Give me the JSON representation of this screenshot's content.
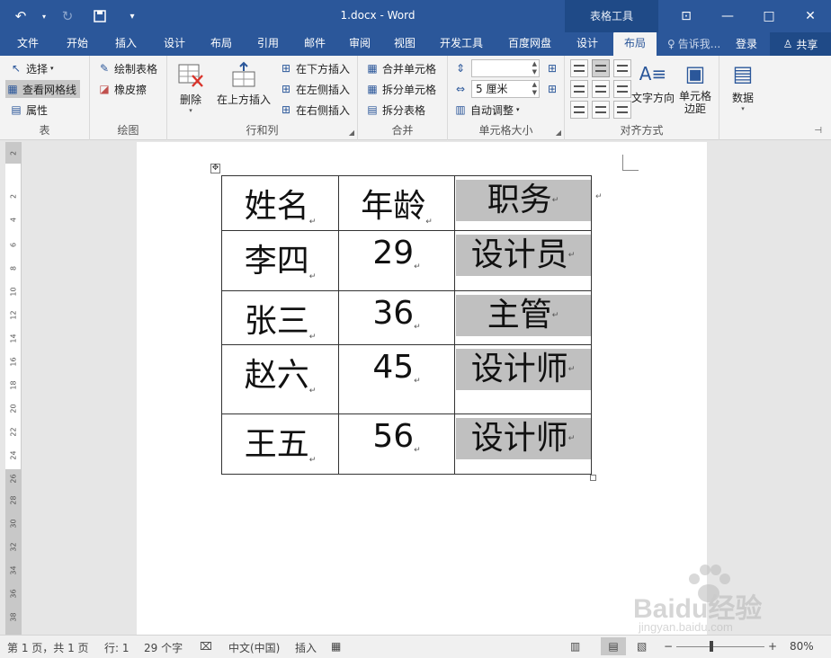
{
  "window": {
    "title": "1.docx - Word",
    "context_tab": "表格工具"
  },
  "tabs": [
    {
      "label": "文件"
    },
    {
      "label": "开始"
    },
    {
      "label": "插入"
    },
    {
      "label": "设计"
    },
    {
      "label": "布局"
    },
    {
      "label": "引用"
    },
    {
      "label": "邮件"
    },
    {
      "label": "审阅"
    },
    {
      "label": "视图"
    },
    {
      "label": "开发工具"
    },
    {
      "label": "百度网盘"
    },
    {
      "label": "设计"
    },
    {
      "label": "布局"
    }
  ],
  "tellme": "告诉我...",
  "signin": "登录",
  "share": "共享",
  "ribbon": {
    "table_group": {
      "label": "表",
      "select": "选择",
      "view_gridlines": "查看网格线",
      "properties": "属性"
    },
    "draw_group": {
      "label": "绘图",
      "draw_table": "绘制表格",
      "eraser": "橡皮擦"
    },
    "rowcol_group": {
      "label": "行和列",
      "delete": "删除",
      "insert_above": "在上方插入",
      "insert_below": "在下方插入",
      "insert_left": "在左侧插入",
      "insert_right": "在右侧插入"
    },
    "merge_group": {
      "label": "合并",
      "merge_cells": "合并单元格",
      "split_cells": "拆分单元格",
      "split_table": "拆分表格"
    },
    "cellsize_group": {
      "label": "单元格大小",
      "height_value": "",
      "width_value": "5 厘米",
      "autofit": "自动调整"
    },
    "align_group": {
      "label": "对齐方式",
      "text_direction": "文字方向",
      "cell_margins": "单元格边距"
    },
    "data_group": {
      "label": "数据"
    }
  },
  "ruler_marks": [
    "2",
    "2",
    "4",
    "6",
    "8",
    "10",
    "12",
    "14",
    "16",
    "18",
    "20",
    "22",
    "24",
    "26",
    "28",
    "30",
    "32",
    "34",
    "36",
    "38"
  ],
  "table": {
    "rows": [
      [
        "姓名",
        "年龄",
        "职务"
      ],
      [
        "李四",
        "29",
        "设计员"
      ],
      [
        "张三",
        "36",
        "主管"
      ],
      [
        "赵六",
        "45",
        "设计师"
      ],
      [
        "王五",
        "56",
        "设计师"
      ]
    ]
  },
  "status": {
    "page": "第 1 页，共 1 页",
    "line": "行: 1",
    "words": "29 个字",
    "language": "中文(中国)",
    "mode": "插入",
    "zoom": "80%"
  },
  "watermark": {
    "brand": "Baidu经验",
    "url": "jingyan.baidu.com"
  },
  "colors": {
    "accent": "#2b579a",
    "cell_shade": "#c0c0c0"
  }
}
